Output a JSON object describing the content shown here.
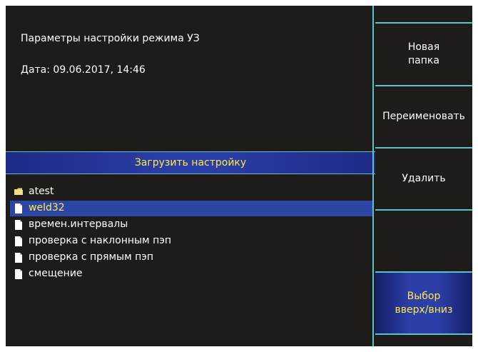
{
  "info": {
    "title": "Параметры настройки режима УЗ",
    "date": "Дата: 09.06.2017, 14:46"
  },
  "load_panel": {
    "header": "Загрузить настройку"
  },
  "files": [
    {
      "name": "atest",
      "icon": "folder-icon",
      "selected": false
    },
    {
      "name": "weld32",
      "icon": "file-icon",
      "selected": true
    },
    {
      "name": "времен.интервалы",
      "icon": "file-icon",
      "selected": false
    },
    {
      "name": "проверка с наклонным пэп",
      "icon": "file-icon",
      "selected": false
    },
    {
      "name": "проверка с прямым пэп",
      "icon": "file-icon",
      "selected": false
    },
    {
      "name": "смещение",
      "icon": "file-icon",
      "selected": false
    }
  ],
  "buttons": {
    "new_folder": "Новая\nпапка",
    "rename": "Переименовать",
    "delete": "Удалить",
    "empty": "",
    "select_updown": "Выбор\nвверх/вниз"
  },
  "colors": {
    "background": "#1e1c1b",
    "accent_line": "#5ec1c8",
    "highlight_text": "#ffe94a",
    "selection": "#2d46a6"
  }
}
